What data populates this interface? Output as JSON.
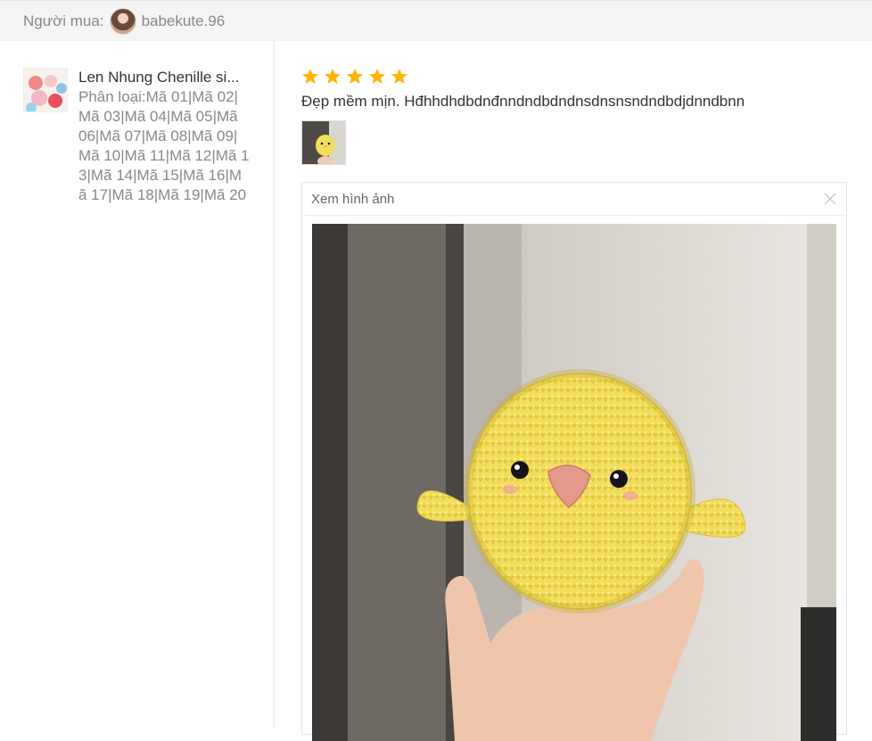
{
  "buyer": {
    "label": "Người mua:",
    "username": "babekute.96"
  },
  "product": {
    "name": "Len Nhung Chenille si...",
    "variant": "Phân loại:Mã 01|Mã 02|Mã 03|Mã 04|Mã 05|Mã 06|Mã 07|Mã 08|Mã 09|Mã 10|Mã 11|Mã 12|Mã 13|Mã 14|Mã 15|Mã 16|Mã 17|Mã 18|Mã 19|Mã 20"
  },
  "review": {
    "rating": 5,
    "comment": "Đẹp mềm mịn. Hđhhdhdbdnđnndndbdndnsdnsnsndndbdjdnndbnn"
  },
  "viewer": {
    "title": "Xem hình ảnh"
  },
  "colors": {
    "star": "#ffb400",
    "chick_yarn": "#f6e36a",
    "beak": "#e7a08e"
  }
}
